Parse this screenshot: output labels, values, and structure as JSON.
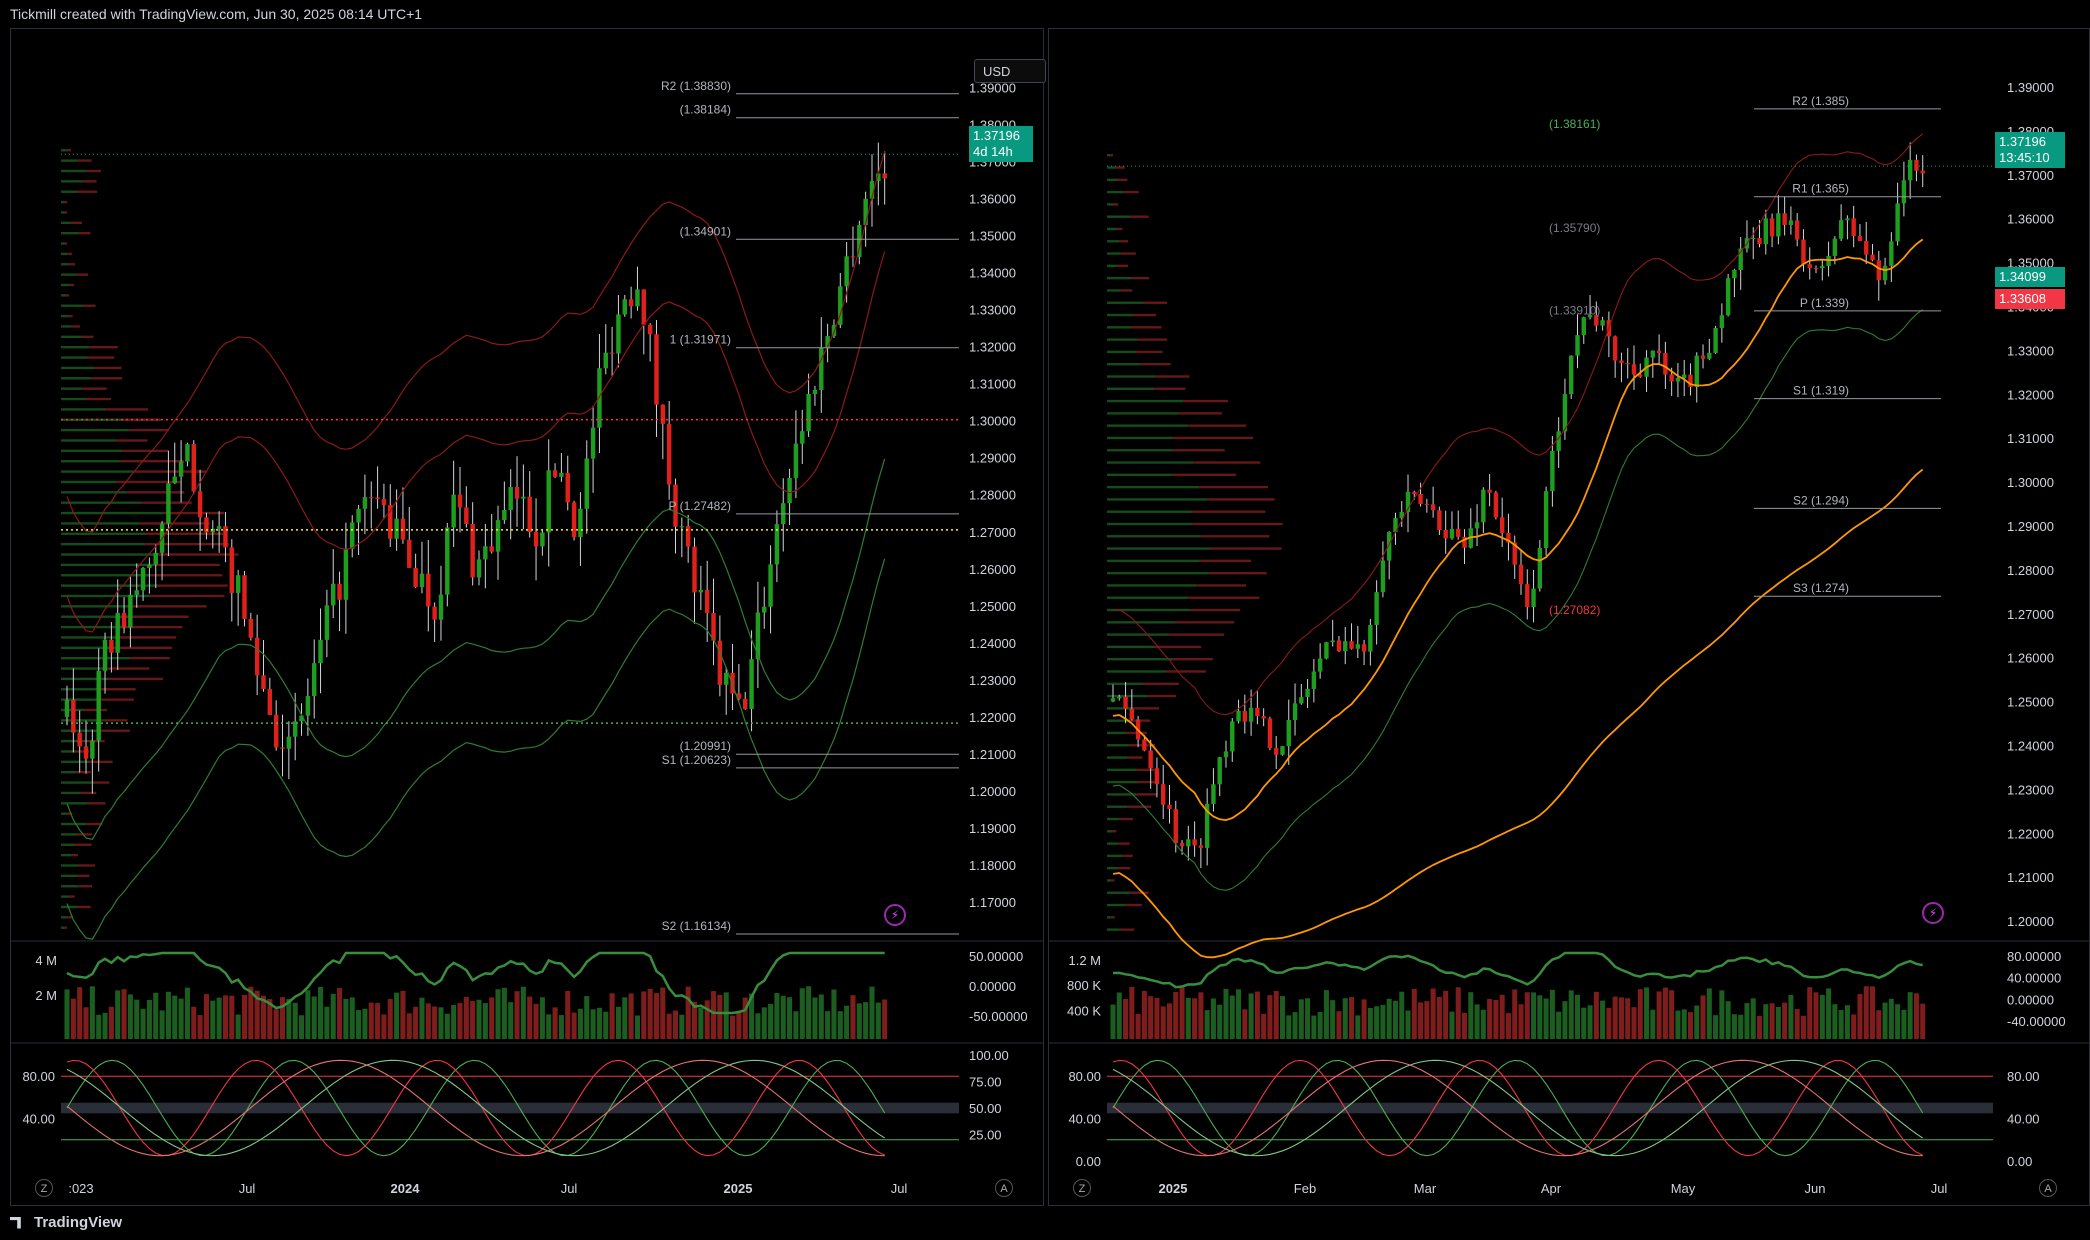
{
  "header": {
    "caption": "Tickmill created with TradingView.com, Jun 30, 2025 08:14 UTC+1"
  },
  "footer": {
    "brand": "TradingView"
  },
  "left": {
    "currency": "USD",
    "price": {
      "last": "1.37196",
      "countdown": "4d 14h"
    },
    "y_ticks": [
      "1.39000",
      "1.38000",
      "1.37000",
      "1.36000",
      "1.35000",
      "1.34000",
      "1.33000",
      "1.32000",
      "1.31000",
      "1.30000",
      "1.29000",
      "1.28000",
      "1.27000",
      "1.26000",
      "1.25000",
      "1.24000",
      "1.23000",
      "1.22000",
      "1.21000",
      "1.20000",
      "1.19000",
      "1.18000",
      "1.17000"
    ],
    "levels": [
      {
        "label": "R2 (1.38830)",
        "value": 1.3883
      },
      {
        "label": "(1.38184)",
        "value": 1.38184
      },
      {
        "label": "(1.34901)",
        "value": 1.34901
      },
      {
        "label": "1 (1.31971)",
        "value": 1.31971
      },
      {
        "label": "P (1.27482)",
        "value": 1.27482
      },
      {
        "label": "(1.20991)",
        "value": 1.20991
      },
      {
        "label": "S1 (1.20623)",
        "value": 1.20623
      },
      {
        "label": "S2 (1.16134)",
        "value": 1.16134
      }
    ],
    "dotted": [
      {
        "value": 1.3003,
        "color": "#f23645"
      },
      {
        "value": 1.2705,
        "color": "#ffeb3b"
      },
      {
        "value": 1.2183,
        "color": "#4caf50"
      }
    ],
    "osc1_ticks": [
      "50.00000",
      "0.00000",
      "-50.00000"
    ],
    "vol_ticks": [
      "4 M",
      "2 M"
    ],
    "stoch_ticks_left": [
      "80.00",
      "40.00"
    ],
    "stoch_ticks_right": [
      "100.00",
      "75.00",
      "50.00",
      "25.00"
    ],
    "x_ticks": [
      ":023",
      "Jul",
      "2024",
      "Jul",
      "2025",
      "Jul"
    ],
    "btn_left": "Z",
    "btn_right": "A"
  },
  "right": {
    "price": {
      "last": "1.37196",
      "countdown": "13:45:10"
    },
    "tag_green": "1.34099",
    "tag_red": "1.33608",
    "y_ticks": [
      "1.39000",
      "1.38000",
      "1.37000",
      "1.36000",
      "1.35000",
      "1.34000",
      "1.33000",
      "1.32000",
      "1.31000",
      "1.30000",
      "1.29000",
      "1.28000",
      "1.27000",
      "1.26000",
      "1.25000",
      "1.24000",
      "1.23000",
      "1.22000",
      "1.21000",
      "1.20000"
    ],
    "levels": [
      {
        "label": "R2 (1.385)",
        "value": 1.385
      },
      {
        "label": "R1 (1.365)",
        "value": 1.365
      },
      {
        "label": "P (1.339)",
        "value": 1.339
      },
      {
        "label": "S1 (1.319)",
        "value": 1.319
      },
      {
        "label": "S2 (1.294)",
        "value": 1.294
      },
      {
        "label": "S3 (1.274)",
        "value": 1.274
      }
    ],
    "annotations": [
      {
        "label": "(1.38161)",
        "value": 1.38161,
        "color": "#4caf50"
      },
      {
        "label": "(1.35790)",
        "value": 1.3579,
        "color": "#787b86"
      },
      {
        "label": "(1.33910)",
        "value": 1.3391,
        "color": "#787b86"
      },
      {
        "label": "(1.27082)",
        "value": 1.27082,
        "color": "#f23645"
      }
    ],
    "osc1_ticks": [
      "80.00000",
      "40.00000",
      "0.00000",
      "-40.00000"
    ],
    "vol_ticks": [
      "1.2 M",
      "800 K",
      "400 K"
    ],
    "stoch_ticks_left": [
      "80.00",
      "40.00",
      "0.00"
    ],
    "stoch_ticks_right": [
      "80.00",
      "40.00",
      "0.00"
    ],
    "x_ticks": [
      "2025",
      "Feb",
      "Mar",
      "Apr",
      "May",
      "Jun",
      "Jul"
    ],
    "btn_left": "Z",
    "btn_right": "A"
  },
  "chart_data": [
    {
      "type": "candlestick",
      "title": "",
      "timeframe_ticks": [
        ":023",
        "Jul",
        "2024",
        "Jul",
        "2025",
        "Jul"
      ],
      "ylim": [
        1.16,
        1.395
      ],
      "series": [
        {
          "name": "",
          "close_path": [
            1.22,
            1.21,
            1.24,
            1.25,
            1.26,
            1.28,
            1.29,
            1.27,
            1.26,
            1.24,
            1.22,
            1.21,
            1.23,
            1.25,
            1.27,
            1.28,
            1.27,
            1.26,
            1.25,
            1.28,
            1.26,
            1.27,
            1.28,
            1.27,
            1.29,
            1.27,
            1.31,
            1.33,
            1.34,
            1.3,
            1.27,
            1.25,
            1.23,
            1.22,
            1.25,
            1.28,
            1.3,
            1.32,
            1.34,
            1.36,
            1.37
          ]
        }
      ]
    },
    {
      "type": "candlestick",
      "title": "",
      "timeframe_ticks": [
        "2025",
        "Feb",
        "Mar",
        "Apr",
        "May",
        "Jun",
        "Jul"
      ],
      "ylim": [
        1.195,
        1.395
      ],
      "series": [
        {
          "name": "",
          "close_path": [
            1.25,
            1.245,
            1.235,
            1.22,
            1.215,
            1.235,
            1.25,
            1.245,
            1.24,
            1.25,
            1.26,
            1.265,
            1.26,
            1.285,
            1.295,
            1.295,
            1.29,
            1.285,
            1.3,
            1.285,
            1.27,
            1.3,
            1.33,
            1.34,
            1.33,
            1.325,
            1.33,
            1.32,
            1.325,
            1.335,
            1.35,
            1.355,
            1.36,
            1.355,
            1.345,
            1.36,
            1.355,
            1.345,
            1.37,
            1.372
          ]
        }
      ]
    }
  ]
}
